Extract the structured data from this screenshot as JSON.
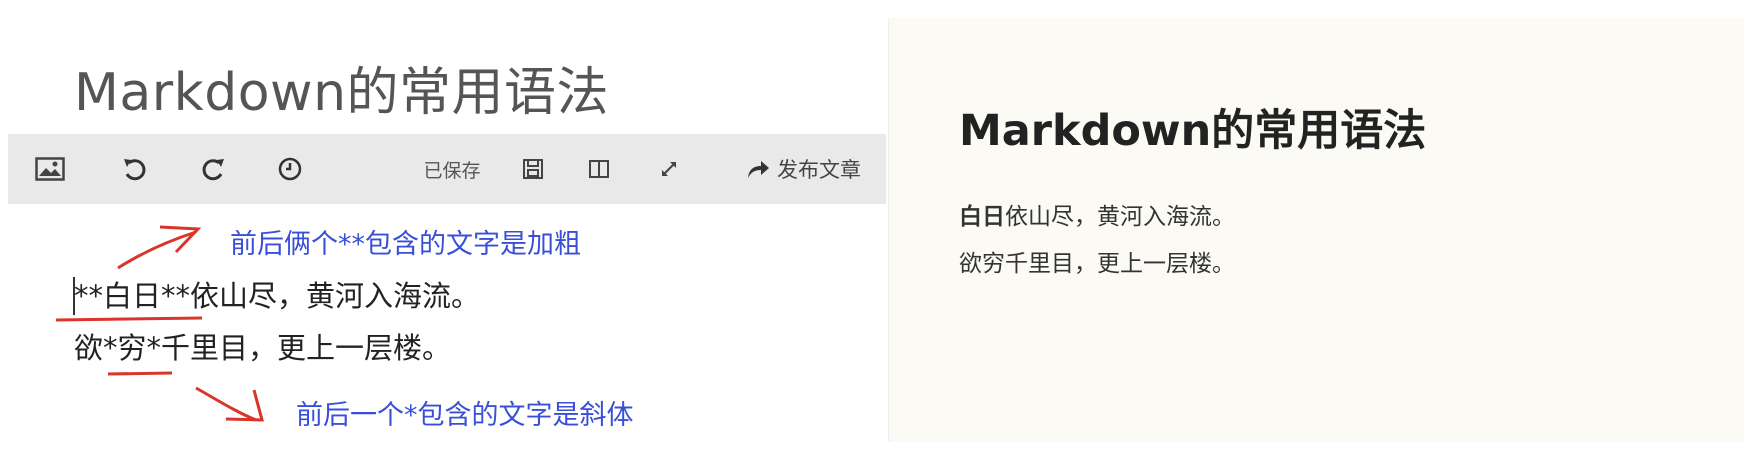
{
  "editor": {
    "title": "Markdown的常用语法",
    "toolbar": {
      "image_icon": "image-icon",
      "undo_icon": "undo-icon",
      "redo_icon": "redo-icon",
      "history_icon": "history-icon",
      "saved_label": "已保存",
      "save_icon": "save-icon",
      "split_view_icon": "split-view-icon",
      "fullscreen_icon": "fullscreen-icon",
      "publish_label": "发布文章",
      "publish_icon": "share-arrow-icon"
    },
    "lines": [
      {
        "bold_marker_open": "**",
        "bold_text": "白日",
        "bold_marker_close": "**",
        "rest": "依山尽，黄河入海流。"
      },
      {
        "prefix": "欲",
        "italic_marker_open": "*",
        "italic_text": "穷",
        "italic_marker_close": "*",
        "rest": "千里目，更上一层楼。"
      }
    ],
    "annotations": {
      "bold_note": "前后俩个**包含的文字是加粗",
      "italic_note": "前后一个*包含的文字是斜体",
      "color": "#3a4fd8",
      "mark_color": "#d9352b"
    }
  },
  "preview": {
    "title": "Markdown的常用语法",
    "line1_bold": "白日",
    "line1_rest": "依山尽，黄河入海流。",
    "line2_prefix": "欲",
    "line2_emph": "穷",
    "line2_rest": "千里目，更上一层楼。",
    "background": "#fbfaf4"
  }
}
